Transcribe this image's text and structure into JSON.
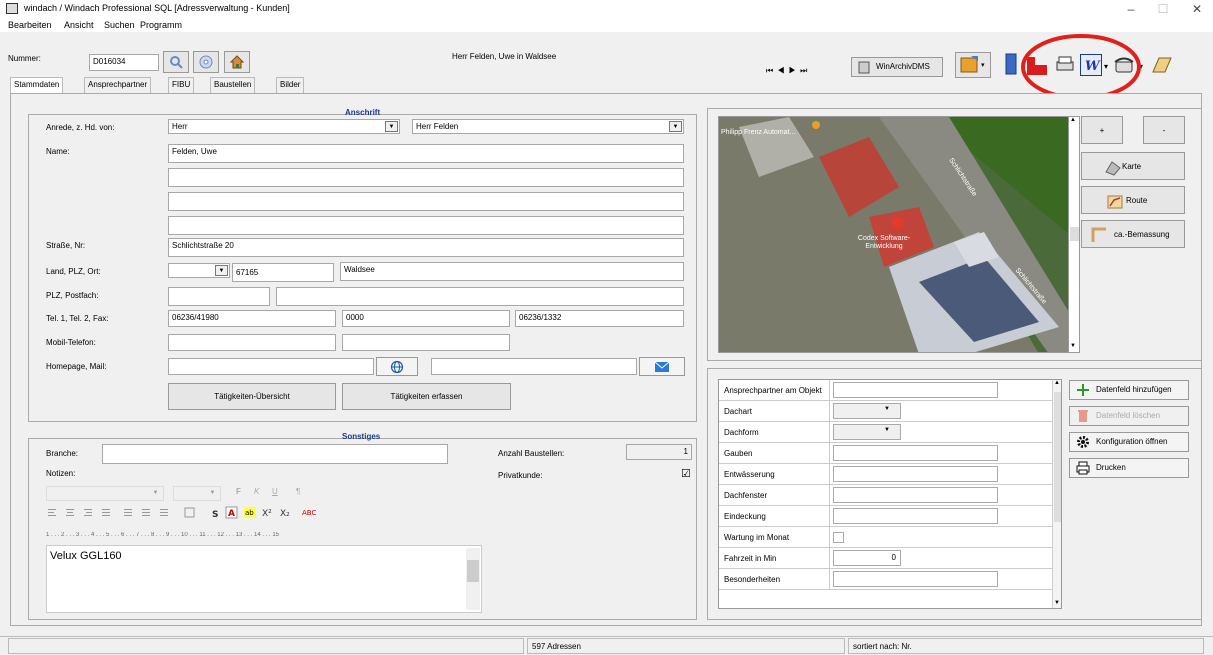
{
  "window": {
    "title": "windach / Windach Professional SQL [Adressverwaltung - Kunden]",
    "minimize": "–",
    "maximize": "☐",
    "close": "✕"
  },
  "menu": {
    "items": [
      "Bearbeiten",
      "Ansicht",
      "Suchen",
      "Programm"
    ]
  },
  "toolbar": {
    "nummer_label": "Nummer:",
    "nummer_value": "D016034",
    "header_text": "Herr Felden, Uwe in Waldsee",
    "nav": "⏮ ◀ ▶ ⏭",
    "winarchiv_label": "WinArchivDMS"
  },
  "tabs": [
    "Stammdaten",
    "Ansprechpartner",
    "FIBU",
    "Baustellen",
    "Bilder"
  ],
  "anschrift": {
    "title": "Anschrift",
    "anrede_label": "Anrede, z. Hd. von:",
    "anrede_value": "Herr",
    "zhd_value": "Herr Felden",
    "name_label": "Name:",
    "name_value": "Felden, Uwe",
    "strasse_label": "Straße, Nr:",
    "strasse_value": "Schlichtstraße 20",
    "land_label": "Land, PLZ, Ort:",
    "land_value": "",
    "plz_value": "67165",
    "ort_value": "Waldsee",
    "postfach_label": "PLZ, Postfach:",
    "tel_label": "Tel. 1, Tel. 2, Fax:",
    "tel1": "06236/41980",
    "tel2": "0000",
    "fax": "06236/1332",
    "mobil_label": "Mobil-Telefon:",
    "homepage_label": "Homepage, Mail:",
    "btn_uebersicht": "Tätigkeiten-Übersicht",
    "btn_erfassen": "Tätigkeiten erfassen"
  },
  "sonstiges": {
    "title": "Sonstiges",
    "branche_label": "Branche:",
    "notizen_label": "Notizen:",
    "anzahl_label": "Anzahl Baustellen:",
    "anzahl_value": "1",
    "privat_label": "Privatkunde:",
    "privat_check": "☑",
    "ruler": "1 . . . 2 . . . 3 . . . 4 . . . 5 . . . 6 . . . 7 . . . 8 . . . 9 . . . 10 . . . 11 . . . 12 . . . 13 . . . 14 . . . 15",
    "note_text": "Velux GGL160",
    "fmt_tools": [
      "F",
      "K",
      "U",
      "¶"
    ]
  },
  "map": {
    "street1": "Schlichtstraße",
    "street2": "Schlichtstraße",
    "poi1": "Philipp Frenz Automat...",
    "poi2": "Codex Software-Entwicklung",
    "plus": "+",
    "minus": "-",
    "karte": "Karte",
    "route": "Route",
    "bemassung": "ca.-Bemassung"
  },
  "objfields": {
    "rows": [
      {
        "label": "Ansprechpartner am Objekt",
        "value": ""
      },
      {
        "label": "Dachart",
        "value": ""
      },
      {
        "label": "Dachform",
        "value": ""
      },
      {
        "label": "Gauben",
        "value": ""
      },
      {
        "label": "Entwässerung",
        "value": ""
      },
      {
        "label": "Dachfenster",
        "value": ""
      },
      {
        "label": "Eindeckung",
        "value": ""
      },
      {
        "label": "Wartung im Monat",
        "value": ""
      },
      {
        "label": "Fahrzeit in Min",
        "value": "0"
      },
      {
        "label": "Besonderheiten",
        "value": ""
      }
    ],
    "btn_add": "Datenfeld hinzufügen",
    "btn_del": "Datenfeld löschen",
    "btn_config": "Konfiguration öffnen",
    "btn_print": "Drucken"
  },
  "status": {
    "count": "597 Adressen",
    "sort": "sortiert nach: Nr."
  },
  "colors": {
    "accent": "#1a3a8a",
    "highlight": "#e0201a",
    "select": "#2866c4"
  }
}
